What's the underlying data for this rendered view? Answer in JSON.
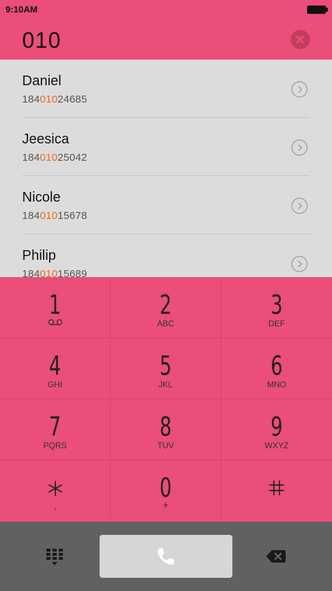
{
  "status_bar": {
    "time": "9:10AM"
  },
  "dial": {
    "number": "010"
  },
  "contacts": [
    {
      "name": "Daniel",
      "phone_pre": "184",
      "phone_match": "010",
      "phone_post": "24685"
    },
    {
      "name": "Jeesica",
      "phone_pre": "184",
      "phone_match": "010",
      "phone_post": "25042"
    },
    {
      "name": "Nicole",
      "phone_pre": "184",
      "phone_match": "010",
      "phone_post": "15678"
    },
    {
      "name": "Philip",
      "phone_pre": "184",
      "phone_match": "010",
      "phone_post": "15689"
    }
  ],
  "keypad": {
    "keys": [
      {
        "digit": "1",
        "letters": ""
      },
      {
        "digit": "2",
        "letters": "ABC"
      },
      {
        "digit": "3",
        "letters": "DEF"
      },
      {
        "digit": "4",
        "letters": "GHI"
      },
      {
        "digit": "5",
        "letters": "JKL"
      },
      {
        "digit": "6",
        "letters": "MNO"
      },
      {
        "digit": "7",
        "letters": "PQRS"
      },
      {
        "digit": "8",
        "letters": "TUV"
      },
      {
        "digit": "9",
        "letters": "WXYZ"
      },
      {
        "digit": "*",
        "letters": ","
      },
      {
        "digit": "0",
        "letters": "+"
      },
      {
        "digit": "#",
        "letters": ""
      }
    ]
  },
  "icons": {
    "clear": "close-circle-icon",
    "chevron": "chevron-right-circle-icon",
    "voicemail": "voicemail-icon",
    "dialpad": "dialpad-icon",
    "call": "phone-icon",
    "backspace": "backspace-icon"
  },
  "colors": {
    "accent": "#ea4e79",
    "highlight": "#ec6a1a",
    "list_bg": "#dcdcdc",
    "bottom_bar": "#616161"
  }
}
